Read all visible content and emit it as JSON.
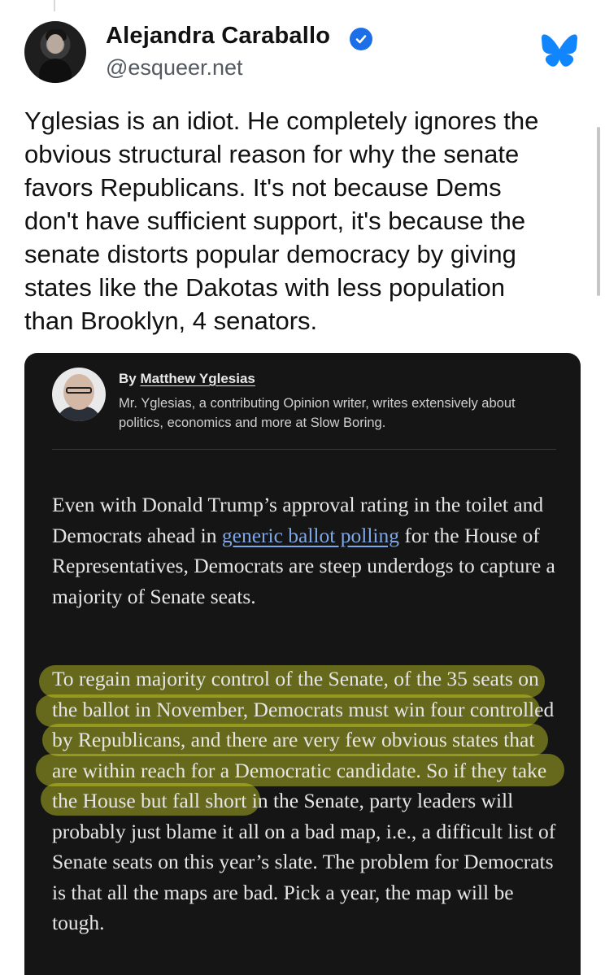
{
  "post": {
    "author_name": "Alejandra Caraballo",
    "author_handle": "@esqueer.net",
    "text": "Yglesias is an idiot. He completely ignores the\nobvious structural reason for why the senate\nfavors Republicans. It's not because Dems\ndon't have sufficient support, it's because the\nsenate distorts popular democracy by giving\nstates like the Dakotas with less population\nthan Brooklyn, 4 senators."
  },
  "embed": {
    "byline_prefix": "By ",
    "byline_author": "Matthew Yglesias",
    "bio": "Mr. Yglesias, a contributing Opinion writer, writes extensively about politics, economics and more at Slow Boring.",
    "para1_before_link": "Even with Donald Trump’s approval rating in the toilet and Democrats ahead in ",
    "para1_link": "generic ballot polling",
    "para1_after_link": " for the House of Representatives, Democrats are steep underdogs to capture a majority of Senate seats.",
    "para2": "To regain majority control of the Senate, of the 35 seats on the ballot in November, Democrats must win four controlled by Republicans, and there are very few obvious states that are within reach for a Democratic candidate. So if they take the House but fall short in the Senate, party leaders will probably just blame it all on a bad map, i.e., a difficult list of Senate seats on this year’s slate. The problem for Democrats is that all the maps are bad. Pick a year, the map will be tough."
  },
  "icons": {
    "verified": "verified-badge-icon",
    "platform": "bluesky-butterfly-icon"
  },
  "colors": {
    "verified_blue": "#1d6fe8",
    "bluesky_blue": "#1185fe",
    "highlight": "#d6de24",
    "embed_background": "#151515",
    "link_blue": "#7fa7e6"
  }
}
